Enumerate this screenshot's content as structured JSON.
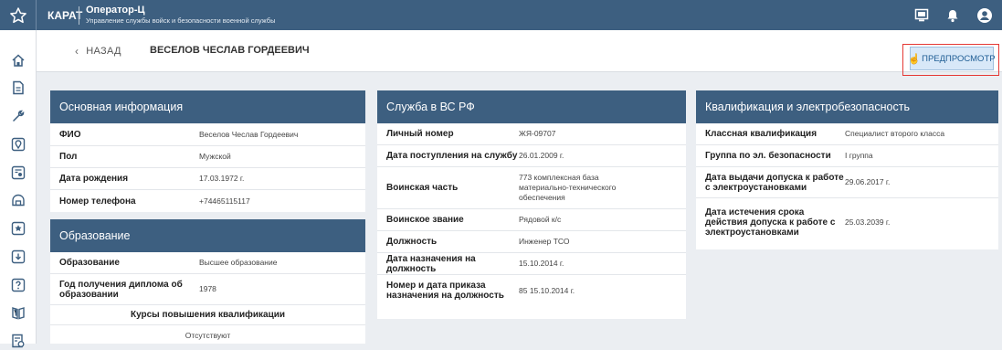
{
  "topbar": {
    "brand": "КАРАТ",
    "app_name": "Оператор-Ц",
    "app_subtitle": "Управление службы войск и безопасности военной службы"
  },
  "header": {
    "back_label": "НАЗАД",
    "person_name": "ВЕСЕЛОВ ЧЕСЛАВ ГОРДЕЕВИЧ",
    "preview_label": "ПРЕДПРОСМОТР"
  },
  "basic": {
    "title": "Основная информация",
    "rows": [
      {
        "label": "ФИО",
        "value": "Веселов Чеслав Гордеевич"
      },
      {
        "label": "Пол",
        "value": "Мужской"
      },
      {
        "label": "Дата рождения",
        "value": "17.03.1972 г."
      },
      {
        "label": "Номер телефона",
        "value": "+74465115117"
      }
    ]
  },
  "education": {
    "title": "Образование",
    "rows": [
      {
        "label": "Образование",
        "value": "Высшее образование"
      },
      {
        "label": "Год получения диплома об образовании",
        "value": "1978"
      }
    ],
    "courses_title": "Курсы повышения квалификации",
    "courses_value": "Отсутствуют"
  },
  "service": {
    "title": "Служба в ВС РФ",
    "rows": [
      {
        "label": "Личный номер",
        "value": "ЖЯ-09707"
      },
      {
        "label": "Дата поступления на службу",
        "value": "26.01.2009 г."
      },
      {
        "label": "Воинская часть",
        "value": "773 комплексная база материально-технического обеспечения"
      },
      {
        "label": "Воинское звание",
        "value": "Рядовой к/с"
      },
      {
        "label": "Должность",
        "value": "Инженер ТСО"
      },
      {
        "label": "Дата назначения на должность",
        "value": "15.10.2014 г."
      },
      {
        "label": "Номер и дата приказа назначения на должность",
        "value": "85 15.10.2014 г."
      }
    ]
  },
  "qualification": {
    "title": "Квалификация и электробезопасность",
    "rows": [
      {
        "label": "Классная квалификация",
        "value": "Специалист второго класса"
      },
      {
        "label": "Группа по эл. безопасности",
        "value": "I группа"
      },
      {
        "label": "Дата выдачи допуска к работе с электроустановками",
        "value": "29.06.2017 г."
      },
      {
        "label": "Дата истечения срока действия допуска к работе с электроустановками",
        "value": "25.03.2039 г."
      }
    ]
  },
  "icons": {
    "topbar": [
      "star-icon",
      "presentation-icon",
      "bell-icon",
      "user-icon"
    ],
    "sidebar": [
      "home-icon",
      "document-icon",
      "wrench-icon",
      "map-pin-icon",
      "id-card-icon",
      "archive-icon",
      "star-badge-icon",
      "download-icon",
      "help-icon",
      "book-icon",
      "report-icon"
    ]
  },
  "colors": {
    "header": "#3d5f80",
    "highlight": "#e53935",
    "button_bg": "#d8e8f8"
  }
}
